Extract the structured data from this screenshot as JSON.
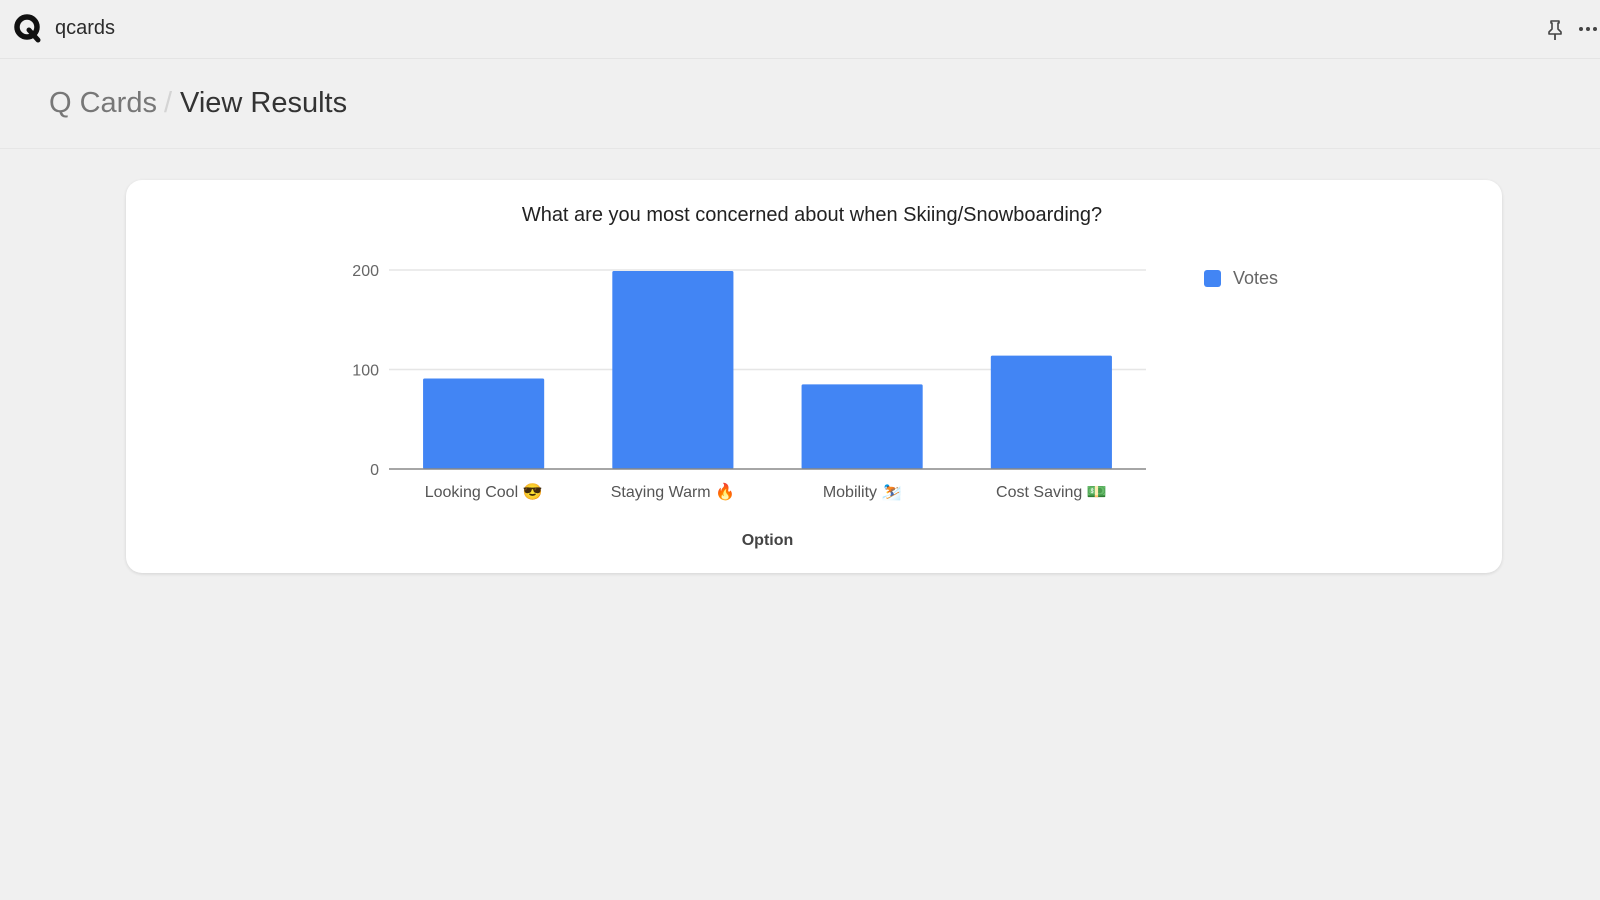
{
  "app": {
    "name": "qcards",
    "logo_icon": "q-logo-icon",
    "pin_icon": "pin-icon",
    "more_icon": "more-horizontal-icon"
  },
  "breadcrumb": {
    "root": "Q Cards",
    "separator": "/",
    "current": "View Results"
  },
  "colors": {
    "bar": "#4285f4",
    "background": "#f0f0f0",
    "card": "#ffffff"
  },
  "chart_data": {
    "type": "bar",
    "title": "What are you most concerned about when Skiing/Snowboarding?",
    "categories": [
      "Looking Cool 😎",
      "Staying Warm 🔥",
      "Mobility ⛷️",
      "Cost Saving 💵"
    ],
    "series": [
      {
        "name": "Votes",
        "values": [
          91,
          199,
          85,
          114
        ],
        "color": "#4285f4"
      }
    ],
    "xlabel": "Option",
    "ylabel": "",
    "ylim": [
      0,
      200
    ],
    "yticks": [
      0,
      100,
      200
    ],
    "grid": true,
    "legend": "right"
  }
}
